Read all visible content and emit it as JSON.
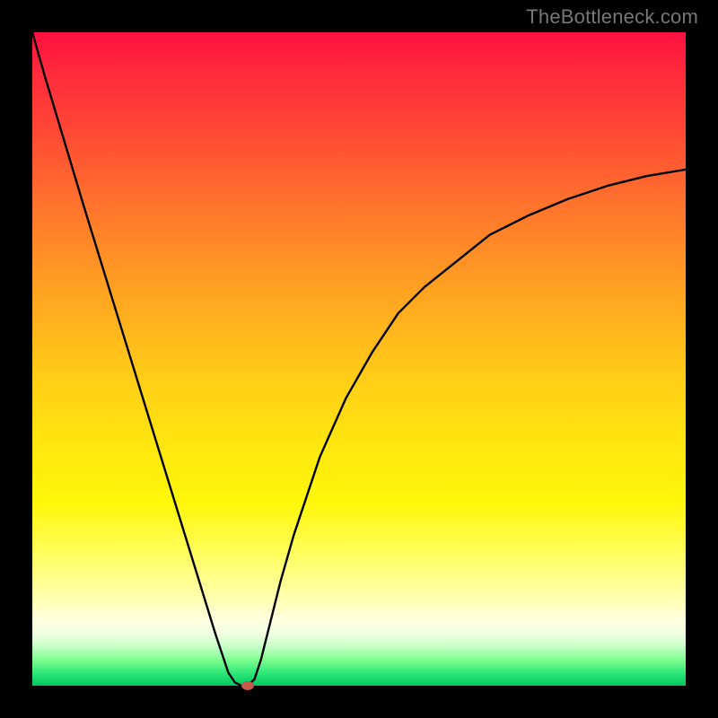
{
  "watermark": "TheBottleneck.com",
  "colors": {
    "frame": "#000000",
    "curve_stroke": "#000000",
    "marker_fill": "#c95a4e",
    "gradient_top": "#ff1040",
    "gradient_mid": "#ffe80e",
    "gradient_bottom": "#00c860"
  },
  "chart_data": {
    "type": "line",
    "title": "",
    "xlabel": "",
    "ylabel": "",
    "xlim": [
      0,
      100
    ],
    "ylim": [
      0,
      100
    ],
    "grid": false,
    "legend": false,
    "x": [
      0,
      2,
      5,
      8,
      12,
      16,
      20,
      24,
      28,
      30,
      31,
      32,
      33,
      34,
      35,
      36,
      38,
      40,
      44,
      48,
      52,
      56,
      60,
      65,
      70,
      76,
      82,
      88,
      94,
      100
    ],
    "y": [
      100,
      93,
      83,
      73,
      60,
      47,
      34,
      21,
      8,
      2,
      0.5,
      0,
      0,
      1,
      4,
      8,
      16,
      23,
      35,
      44,
      51,
      57,
      61,
      65,
      69,
      72,
      74.5,
      76.5,
      78,
      79
    ],
    "marker": {
      "x": 33,
      "y": 0
    },
    "note": "Values are read from the plotted curve relative to plot axes; axes have no tick labels so units are normalized 0–100."
  }
}
